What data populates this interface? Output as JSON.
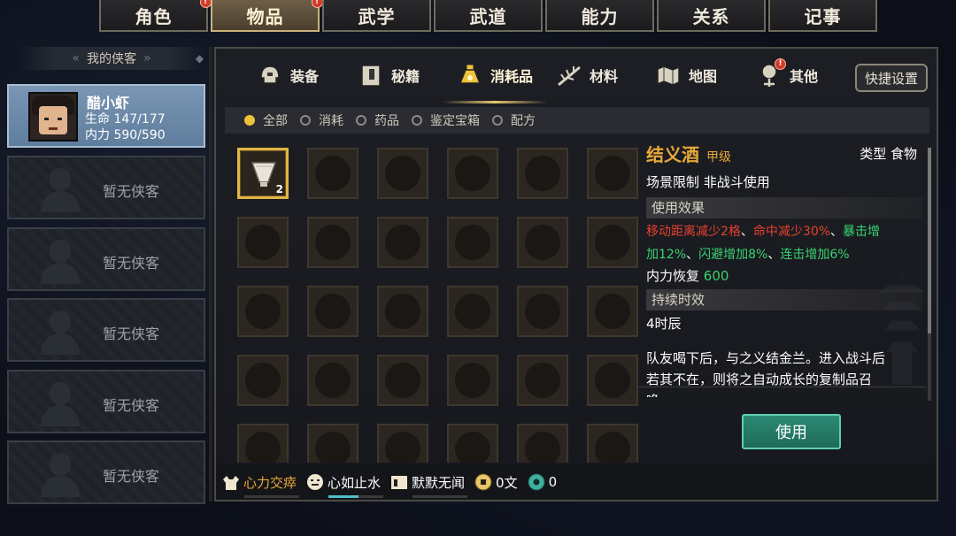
{
  "top_tabs": [
    {
      "label": "角色",
      "badge": "!",
      "active": false
    },
    {
      "label": "物品",
      "badge": "!",
      "active": true
    },
    {
      "label": "武学",
      "badge": "",
      "active": false
    },
    {
      "label": "武道",
      "badge": "",
      "active": false
    },
    {
      "label": "能力",
      "badge": "",
      "active": false
    },
    {
      "label": "关系",
      "badge": "",
      "active": false
    },
    {
      "label": "记事",
      "badge": "",
      "active": false
    }
  ],
  "party": {
    "header": "我的侠客",
    "hero": {
      "name": "醋小虾",
      "hp_label": "生命",
      "hp": "147/177",
      "mp_label": "内力",
      "mp": "590/590"
    },
    "empty_slots": [
      "暂无侠客",
      "暂无侠客",
      "暂无侠客",
      "暂无侠客",
      "暂无侠客"
    ]
  },
  "sub_tabs": [
    {
      "label": "装备",
      "icon": "helmet-icon"
    },
    {
      "label": "秘籍",
      "icon": "book-icon"
    },
    {
      "label": "消耗品",
      "icon": "potion-icon",
      "active": true
    },
    {
      "label": "材料",
      "icon": "herb-icon"
    },
    {
      "label": "地图",
      "icon": "map-icon"
    },
    {
      "label": "其他",
      "icon": "misc-icon",
      "badge": "!"
    }
  ],
  "quick_settings": "快捷设置",
  "filters": [
    {
      "label": "全部",
      "active": true
    },
    {
      "label": "消耗",
      "active": false
    },
    {
      "label": "药品",
      "active": false
    },
    {
      "label": "鉴定宝箱",
      "active": false
    },
    {
      "label": "配方",
      "active": false
    }
  ],
  "inventory": {
    "first_item_count": "2",
    "item_icon": "wine-cup-icon"
  },
  "detail": {
    "name": "结义酒",
    "grade": "甲级",
    "type": "类型  食物",
    "scene": "场景限制   非战斗使用",
    "effect_header": "使用效果",
    "effect": {
      "e1": "移动距离减少2格",
      "sep1": "、",
      "e2": "命中减少30%",
      "sep2": "、",
      "e3a": "暴击增",
      "e3b": "加12%",
      "sep3": "、",
      "e4": "闪避增加8%",
      "sep4": "、",
      "e5": "连击增加6%"
    },
    "mp_restore_label": "内力恢复",
    "mp_restore_value": "600",
    "duration_header": "持续时效",
    "duration": "4时辰",
    "description_1": "队友喝下后，与之义结金兰。进入战斗后",
    "description_2": "若其不在，则将之自动成长的复制品召",
    "description_3": "唤"
  },
  "use_button": "使用",
  "status_bar": {
    "s1": "心力交瘁",
    "s2": "心如止水",
    "s3": "默默无闻",
    "money": "0文",
    "jade": "0"
  },
  "colors": {
    "accent_gold": "#e9a937",
    "positive": "#39d36f",
    "negative": "#e8412e",
    "use_button": "#2b8a74"
  }
}
